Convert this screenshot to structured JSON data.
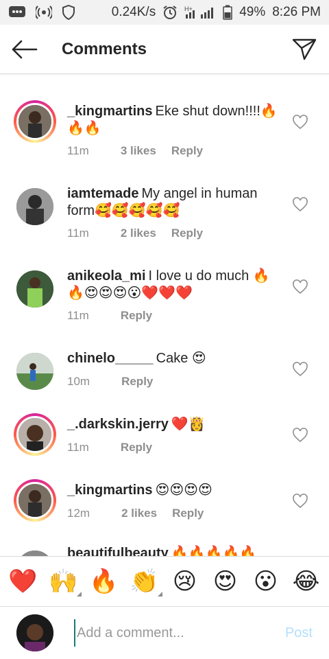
{
  "status_bar": {
    "speed": "0.24K/s",
    "battery": "49%",
    "time": "8:26 PM",
    "network": "H+"
  },
  "header": {
    "title": "Comments"
  },
  "comments": [
    {
      "username": "_kingmartins",
      "text": "Eke shut down!!!!🔥🔥🔥",
      "time": "11m",
      "likes": "3 likes",
      "reply": "Reply",
      "story_ring": true
    },
    {
      "username": "iamtemade",
      "text": "My angel in human form🥰🥰🥰🥰🥰",
      "time": "11m",
      "likes": "2 likes",
      "reply": "Reply",
      "story_ring": false
    },
    {
      "username": "anikeola_mi",
      "text": "I love u do much 🔥🔥😍😍😍😮❤️❤️❤️",
      "time": "11m",
      "likes": "",
      "reply": "Reply",
      "story_ring": false
    },
    {
      "username": "chinelo_____",
      "text": "Cake 😍",
      "time": "10m",
      "likes": "",
      "reply": "Reply",
      "story_ring": false
    },
    {
      "username": "_.darkskin.jerry",
      "text": "❤️👸",
      "time": "11m",
      "likes": "",
      "reply": "Reply",
      "story_ring": true
    },
    {
      "username": "_kingmartins",
      "text": "😍😍😍😍",
      "time": "12m",
      "likes": "2 likes",
      "reply": "Reply",
      "story_ring": true
    },
    {
      "username": "beautifulbeauty",
      "text": "🔥🔥🔥🔥🔥",
      "time": "",
      "likes": "",
      "reply": "",
      "story_ring": false
    }
  ],
  "emoji_bar": [
    "❤️",
    "🙌",
    "🔥",
    "👏",
    "😢",
    "😍",
    "😮",
    "😂"
  ],
  "composer": {
    "placeholder": "Add a comment...",
    "post_label": "Post"
  },
  "colors": {
    "heart_pink": "#ed4c8c",
    "post_disabled": "#b2dffc",
    "meta_gray": "#8e8e8e"
  }
}
